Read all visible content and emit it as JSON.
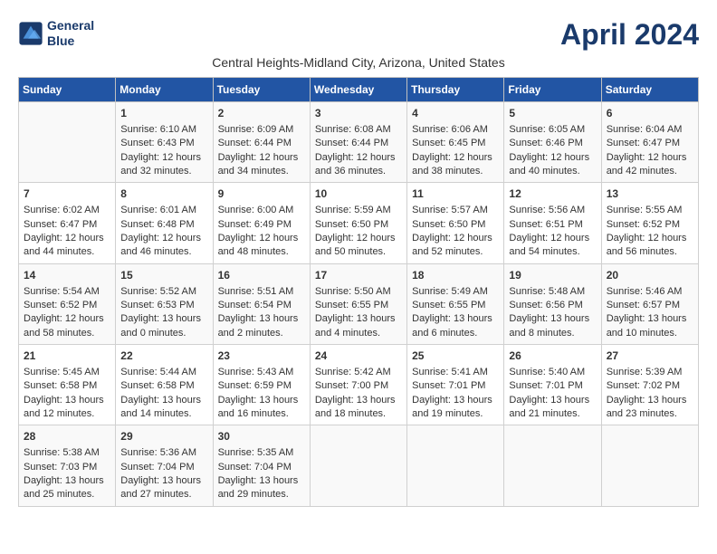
{
  "app": {
    "logo_line1": "General",
    "logo_line2": "Blue"
  },
  "header": {
    "title": "April 2024",
    "subtitle": "Central Heights-Midland City, Arizona, United States"
  },
  "columns": [
    "Sunday",
    "Monday",
    "Tuesday",
    "Wednesday",
    "Thursday",
    "Friday",
    "Saturday"
  ],
  "weeks": [
    {
      "cells": [
        {
          "day": "",
          "text": ""
        },
        {
          "day": "1",
          "text": "Sunrise: 6:10 AM\nSunset: 6:43 PM\nDaylight: 12 hours\nand 32 minutes."
        },
        {
          "day": "2",
          "text": "Sunrise: 6:09 AM\nSunset: 6:44 PM\nDaylight: 12 hours\nand 34 minutes."
        },
        {
          "day": "3",
          "text": "Sunrise: 6:08 AM\nSunset: 6:44 PM\nDaylight: 12 hours\nand 36 minutes."
        },
        {
          "day": "4",
          "text": "Sunrise: 6:06 AM\nSunset: 6:45 PM\nDaylight: 12 hours\nand 38 minutes."
        },
        {
          "day": "5",
          "text": "Sunrise: 6:05 AM\nSunset: 6:46 PM\nDaylight: 12 hours\nand 40 minutes."
        },
        {
          "day": "6",
          "text": "Sunrise: 6:04 AM\nSunset: 6:47 PM\nDaylight: 12 hours\nand 42 minutes."
        }
      ]
    },
    {
      "cells": [
        {
          "day": "7",
          "text": "Sunrise: 6:02 AM\nSunset: 6:47 PM\nDaylight: 12 hours\nand 44 minutes."
        },
        {
          "day": "8",
          "text": "Sunrise: 6:01 AM\nSunset: 6:48 PM\nDaylight: 12 hours\nand 46 minutes."
        },
        {
          "day": "9",
          "text": "Sunrise: 6:00 AM\nSunset: 6:49 PM\nDaylight: 12 hours\nand 48 minutes."
        },
        {
          "day": "10",
          "text": "Sunrise: 5:59 AM\nSunset: 6:50 PM\nDaylight: 12 hours\nand 50 minutes."
        },
        {
          "day": "11",
          "text": "Sunrise: 5:57 AM\nSunset: 6:50 PM\nDaylight: 12 hours\nand 52 minutes."
        },
        {
          "day": "12",
          "text": "Sunrise: 5:56 AM\nSunset: 6:51 PM\nDaylight: 12 hours\nand 54 minutes."
        },
        {
          "day": "13",
          "text": "Sunrise: 5:55 AM\nSunset: 6:52 PM\nDaylight: 12 hours\nand 56 minutes."
        }
      ]
    },
    {
      "cells": [
        {
          "day": "14",
          "text": "Sunrise: 5:54 AM\nSunset: 6:52 PM\nDaylight: 12 hours\nand 58 minutes."
        },
        {
          "day": "15",
          "text": "Sunrise: 5:52 AM\nSunset: 6:53 PM\nDaylight: 13 hours\nand 0 minutes."
        },
        {
          "day": "16",
          "text": "Sunrise: 5:51 AM\nSunset: 6:54 PM\nDaylight: 13 hours\nand 2 minutes."
        },
        {
          "day": "17",
          "text": "Sunrise: 5:50 AM\nSunset: 6:55 PM\nDaylight: 13 hours\nand 4 minutes."
        },
        {
          "day": "18",
          "text": "Sunrise: 5:49 AM\nSunset: 6:55 PM\nDaylight: 13 hours\nand 6 minutes."
        },
        {
          "day": "19",
          "text": "Sunrise: 5:48 AM\nSunset: 6:56 PM\nDaylight: 13 hours\nand 8 minutes."
        },
        {
          "day": "20",
          "text": "Sunrise: 5:46 AM\nSunset: 6:57 PM\nDaylight: 13 hours\nand 10 minutes."
        }
      ]
    },
    {
      "cells": [
        {
          "day": "21",
          "text": "Sunrise: 5:45 AM\nSunset: 6:58 PM\nDaylight: 13 hours\nand 12 minutes."
        },
        {
          "day": "22",
          "text": "Sunrise: 5:44 AM\nSunset: 6:58 PM\nDaylight: 13 hours\nand 14 minutes."
        },
        {
          "day": "23",
          "text": "Sunrise: 5:43 AM\nSunset: 6:59 PM\nDaylight: 13 hours\nand 16 minutes."
        },
        {
          "day": "24",
          "text": "Sunrise: 5:42 AM\nSunset: 7:00 PM\nDaylight: 13 hours\nand 18 minutes."
        },
        {
          "day": "25",
          "text": "Sunrise: 5:41 AM\nSunset: 7:01 PM\nDaylight: 13 hours\nand 19 minutes."
        },
        {
          "day": "26",
          "text": "Sunrise: 5:40 AM\nSunset: 7:01 PM\nDaylight: 13 hours\nand 21 minutes."
        },
        {
          "day": "27",
          "text": "Sunrise: 5:39 AM\nSunset: 7:02 PM\nDaylight: 13 hours\nand 23 minutes."
        }
      ]
    },
    {
      "cells": [
        {
          "day": "28",
          "text": "Sunrise: 5:38 AM\nSunset: 7:03 PM\nDaylight: 13 hours\nand 25 minutes."
        },
        {
          "day": "29",
          "text": "Sunrise: 5:36 AM\nSunset: 7:04 PM\nDaylight: 13 hours\nand 27 minutes."
        },
        {
          "day": "30",
          "text": "Sunrise: 5:35 AM\nSunset: 7:04 PM\nDaylight: 13 hours\nand 29 minutes."
        },
        {
          "day": "",
          "text": ""
        },
        {
          "day": "",
          "text": ""
        },
        {
          "day": "",
          "text": ""
        },
        {
          "day": "",
          "text": ""
        }
      ]
    }
  ]
}
